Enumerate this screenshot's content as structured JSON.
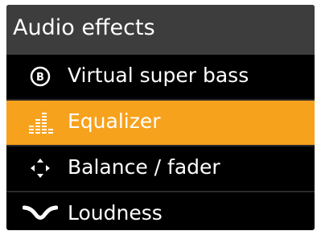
{
  "header": {
    "title": "Audio effects"
  },
  "menu": {
    "items": [
      {
        "label": "Virtual super bass",
        "icon": "bass-icon",
        "selected": false
      },
      {
        "label": "Equalizer",
        "icon": "equalizer-icon",
        "selected": true
      },
      {
        "label": "Balance / fader",
        "icon": "balance-fader-icon",
        "selected": false
      },
      {
        "label": "Loudness",
        "icon": "loudness-icon",
        "selected": false
      }
    ]
  },
  "colors": {
    "header_bg": "#3d3d3d",
    "selected_bg": "#f7a21c",
    "text": "#ffffff",
    "background": "#000000"
  }
}
